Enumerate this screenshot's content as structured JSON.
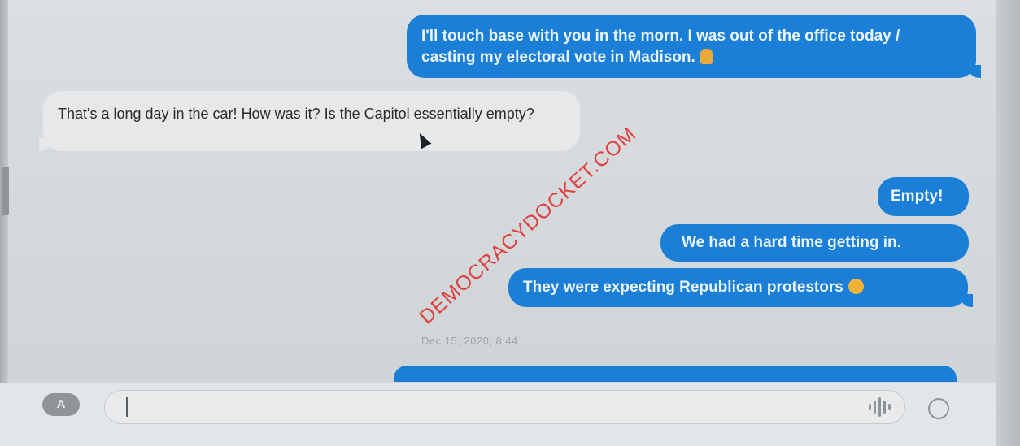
{
  "messages": [
    {
      "direction": "outgoing",
      "text": "I'll touch base with you in the morn. I was out of the office today / casting my electoral vote in Madison."
    },
    {
      "direction": "incoming",
      "text": "That's a long day in the car! How was it? Is the Capitol essentially empty?"
    },
    {
      "direction": "outgoing",
      "text": "Empty!"
    },
    {
      "direction": "outgoing",
      "text": "We had a hard time getting in."
    },
    {
      "direction": "outgoing",
      "text": "They were expecting Republican protestors"
    }
  ],
  "timestamp": "Dec 15, 2020, 8:44",
  "composer": {
    "app_icon_label": "A",
    "placeholder": ""
  },
  "icons": [
    "person-emoji-icon",
    "face-emoji-icon",
    "appstore-icon",
    "audio-wave-icon",
    "emoji-picker-icon",
    "mouse-cursor-icon"
  ],
  "watermark": "DEMOCRACYDOCKET.COM",
  "colors": {
    "outgoing_bubble": "#1b7fd8",
    "incoming_bubble": "#e6e8ea",
    "watermark": "#e02828"
  }
}
